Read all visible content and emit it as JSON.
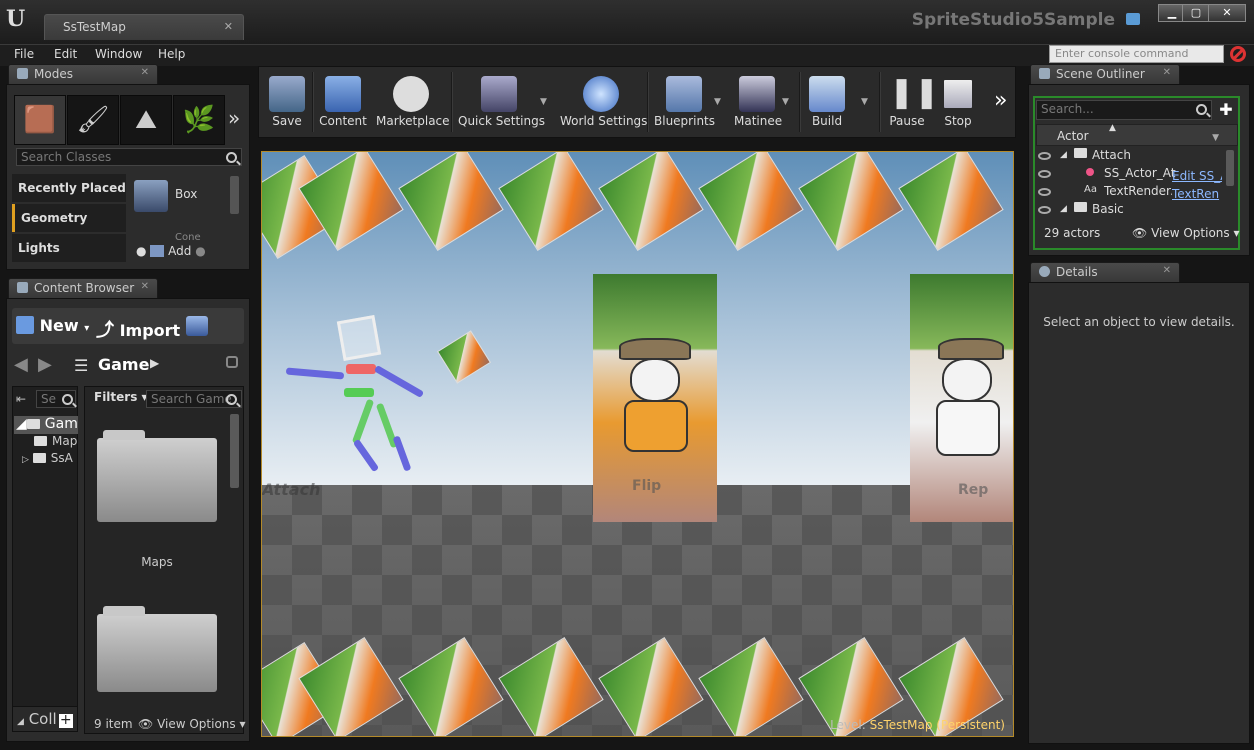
{
  "window": {
    "tab_title": "SsTestMap",
    "project_title": "SpriteStudio5Sample",
    "minimize": "▁",
    "maximize": "▢",
    "close": "✕"
  },
  "menu": [
    "File",
    "Edit",
    "Window",
    "Help"
  ],
  "console": {
    "placeholder": "Enter console command"
  },
  "modes": {
    "tab": "Modes",
    "search_placeholder": "Search Classes",
    "categories": [
      "Recently Placed",
      "Geometry",
      "Lights"
    ],
    "items": [
      "Box",
      "Cone"
    ],
    "add_label": "Add",
    "more": "»"
  },
  "content_browser": {
    "tab": "Content Browser",
    "new_label": "New",
    "import_label": "Import",
    "path": "Game",
    "tree": {
      "search_placeholder": "Se",
      "root": "Gam",
      "children": [
        "Map",
        "SsA"
      ]
    },
    "filters_label": "Filters",
    "search_placeholder": "Search Game",
    "folders": [
      "Maps"
    ],
    "item_count": "9 item",
    "view_options": "View Options",
    "collections": "Coll"
  },
  "toolbar": {
    "buttons": [
      "Save",
      "Content",
      "Marketplace",
      "Quick Settings",
      "World Settings",
      "Blueprints",
      "Matinee",
      "Build",
      "Pause",
      "Stop"
    ],
    "more": "»"
  },
  "viewport": {
    "level_label": "Level:",
    "level_name": "SsTestMap (Persistent)",
    "scene_texts": [
      "Attach",
      "Flip",
      "Rep"
    ]
  },
  "outliner": {
    "tab": "Scene Outliner",
    "search_placeholder": "Search...",
    "column": "Actor",
    "rows": [
      {
        "label": "Attach",
        "type": "folder"
      },
      {
        "label": "SS_Actor_Att",
        "type": "actor",
        "link": "Edit SS_A"
      },
      {
        "label": "TextRenderA",
        "type": "text",
        "link": "TextRen"
      },
      {
        "label": "Basic",
        "type": "folder"
      }
    ],
    "count": "29 actors",
    "view_options": "View Options"
  },
  "details": {
    "tab": "Details",
    "empty_text": "Select an object to view details."
  }
}
